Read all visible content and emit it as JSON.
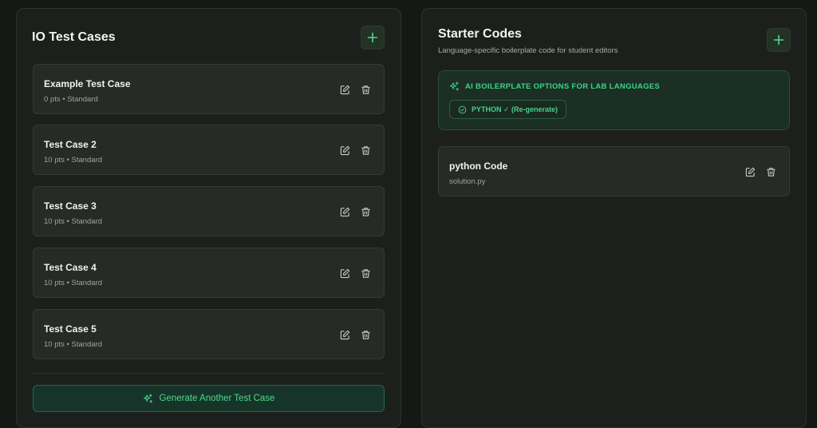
{
  "test_cases_panel": {
    "title": "IO Test Cases",
    "add_icon": "plus-icon",
    "cases": [
      {
        "title": "Example Test Case",
        "meta": "0 pts • Standard"
      },
      {
        "title": "Test Case 2",
        "meta": "10 pts • Standard"
      },
      {
        "title": "Test Case 3",
        "meta": "10 pts • Standard"
      },
      {
        "title": "Test Case 4",
        "meta": "10 pts • Standard"
      },
      {
        "title": "Test Case 5",
        "meta": "10 pts • Standard"
      }
    ],
    "edit_icon": "edit-icon",
    "delete_icon": "trash-icon",
    "generate_label": "Generate Another Test Case",
    "generate_icon": "sparkle-icon"
  },
  "starter_codes_panel": {
    "title": "Starter Codes",
    "subtitle": "Language-specific boilerplate code for student editors",
    "add_icon": "plus-icon",
    "ai_box": {
      "heading": "AI BOILERPLATE OPTIONS FOR LAB LANGUAGES",
      "heading_icon": "sparkle-icon",
      "language_option": "PYTHON ✓ (Re-generate)",
      "option_icon": "check-circle-icon"
    },
    "code_entry": {
      "title": "python Code",
      "filename": "solution.py"
    }
  },
  "colors": {
    "background": "#161816",
    "panel": "#1c1f1c",
    "card": "#272a26",
    "accent_green": "#4fd98d"
  }
}
